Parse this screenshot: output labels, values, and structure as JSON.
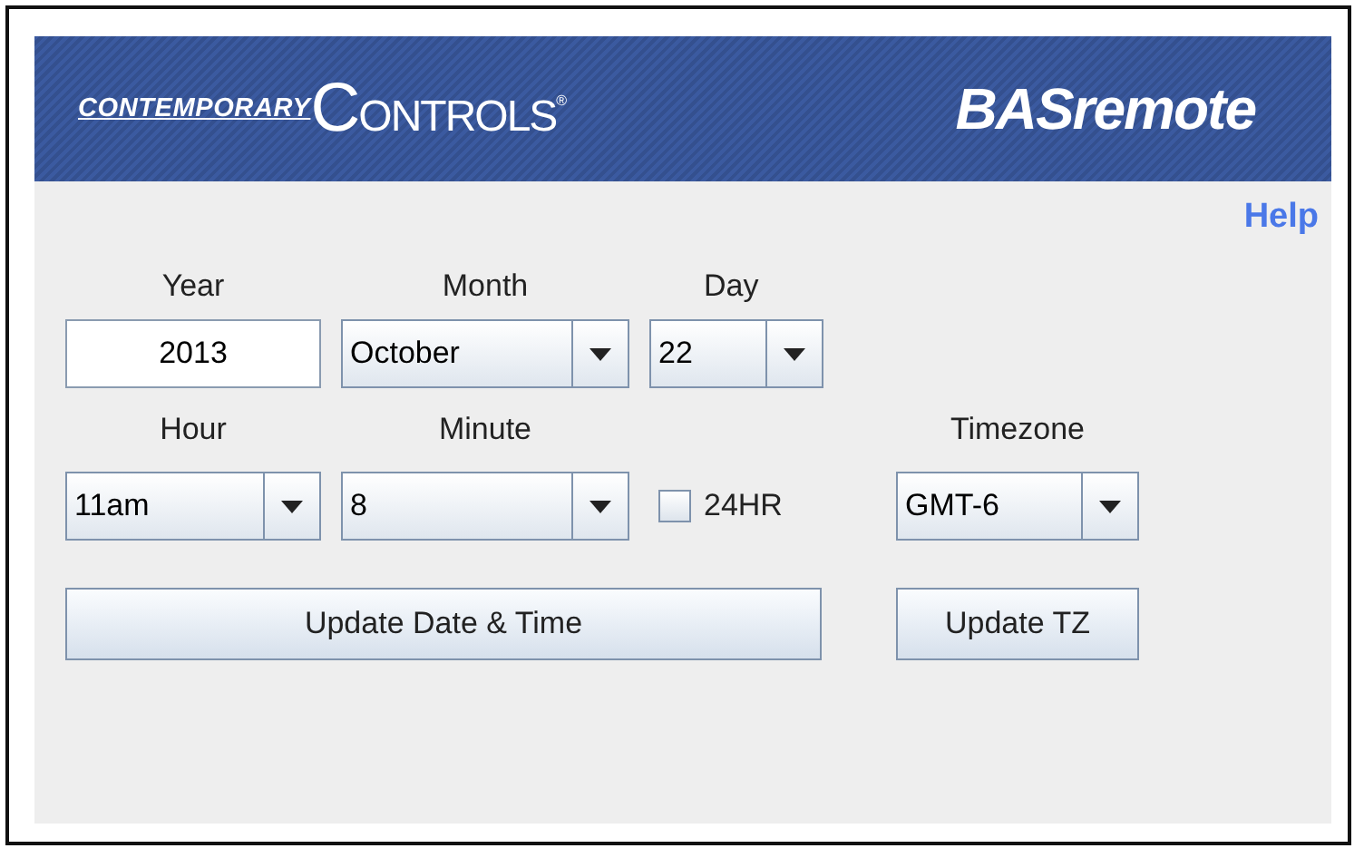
{
  "header": {
    "logo_prefix": "CONTEMPORARY",
    "logo_name": "CONTROLS",
    "logo_mark": "®",
    "product": "BASremote"
  },
  "help_link": "Help",
  "year": {
    "label": "Year",
    "value": "2013"
  },
  "month": {
    "label": "Month",
    "value": "October"
  },
  "day": {
    "label": "Day",
    "value": "22"
  },
  "hour": {
    "label": "Hour",
    "value": "11am"
  },
  "minute": {
    "label": "Minute",
    "value": "8"
  },
  "hr24": {
    "label": "24HR",
    "checked": false
  },
  "timezone": {
    "label": "Timezone",
    "value": "GMT-6"
  },
  "buttons": [
    {
      "label": "Update Date & Time"
    },
    {
      "label": "Update TZ"
    }
  ]
}
